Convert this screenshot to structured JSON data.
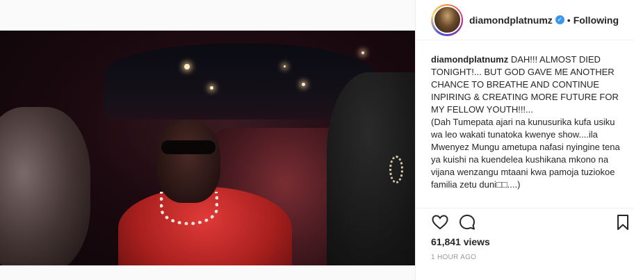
{
  "post": {
    "username": "diamondplatnumz",
    "verified_icon": "verified-badge-icon",
    "separator": "•",
    "follow_status": "Following",
    "caption_user": "diamondplatnumz",
    "caption_line1": "DAH!!! ALMOST DIED TONIGHT!... BUT GOD GAVE ME ANOTHER CHANCE TO BREATHE AND CONTINUE INPIRING & CREATING MORE FUTURE FOR MY FELLOW YOUTH!!!...",
    "caption_line2": "(Dah Tumepata ajari na kunusurika kufa usiku wa leo wakati tunatoka kwenye show....ila Mwenyez Mungu ametupa nafasi nyingine tena ya kuishi na kuendelea kushikana mkono na vijana wenzangu mtaani kwa pamoja tuziokoe familia zetu duni□□....)",
    "views": "61,841 views",
    "timestamp": "1 HOUR AGO"
  },
  "icons": {
    "like": "heart-icon",
    "comment": "comment-icon",
    "bookmark": "bookmark-icon"
  },
  "colors": {
    "verified_blue": "#3897f0",
    "video_shirt_red": "#c42624",
    "muted_text": "#999999"
  }
}
